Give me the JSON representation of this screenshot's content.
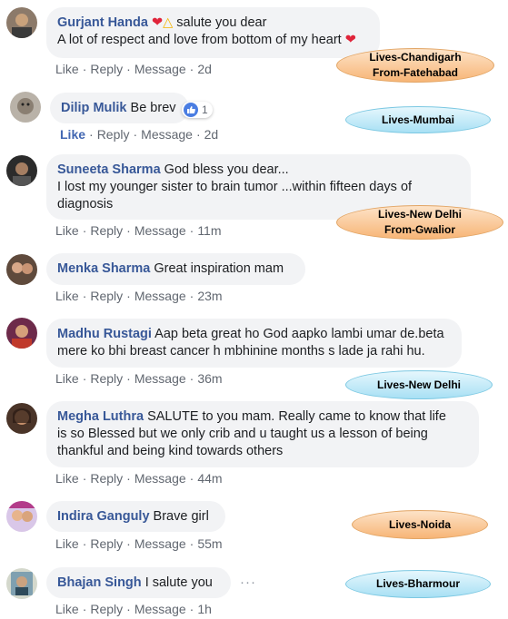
{
  "comments": [
    {
      "name": "Gurjant Handa",
      "text1": " salute you dear",
      "text2": "A lot of respect and love from bottom of my heart ",
      "time": "2d"
    },
    {
      "name": "Dilip Mulik",
      "text1": "Be brev",
      "reactions": "1",
      "time": "2d"
    },
    {
      "name": "Suneeta Sharma",
      "text1": "God bless you dear...",
      "text2": "I lost my younger sister to brain tumor ...within fifteen days of",
      "text3": "diagnosis",
      "time": "11m"
    },
    {
      "name": "Menka Sharma",
      "text1": "Great inspiration mam",
      "time": "23m"
    },
    {
      "name": "Madhu Rustagi",
      "text1": "Aap beta great ho God aapko lambi umar de.beta",
      "text2": "mere ko bhi breast cancer h mbhinine months s lade ja rahi hu.",
      "time": "36m"
    },
    {
      "name": "Megha Luthra",
      "text1": "SALUTE to you mam. Really came to know that life",
      "text2": "is so Blessed but we only crib and u taught us a lesson of being",
      "text3": "thankful and being kind towards others",
      "time": "44m"
    },
    {
      "name": "Indira Ganguly",
      "text1": "Brave girl",
      "time": "55m"
    },
    {
      "name": "Bhajan Singh",
      "text1": "I salute you",
      "time": "1h"
    }
  ],
  "actions": {
    "like": "Like",
    "reply": "Reply",
    "message": "Message",
    "sep": "·"
  },
  "tags": [
    {
      "line1": "Lives-Chandigarh",
      "line2": "From-Fatehabad"
    },
    {
      "line1": "Lives-Mumbai"
    },
    {
      "line1": "Lives-New Delhi",
      "line2": "From-Gwalior"
    },
    {
      "line1": "Lives-New Delhi"
    },
    {
      "line1": "Lives-Noida"
    },
    {
      "line1": "Lives-Bharmour"
    }
  ],
  "icons": {
    "heart": "heart-icon",
    "praying_hands": "praying-hands-icon",
    "thumbs_up": "thumbs-up-icon",
    "more": "more-options-icon"
  },
  "colors": {
    "name": "#385898",
    "bubble": "#f2f3f5",
    "meta": "#616770",
    "like_active": "#4267b2",
    "tag_orange": "#f7b576",
    "tag_blue": "#a8e0f4"
  }
}
